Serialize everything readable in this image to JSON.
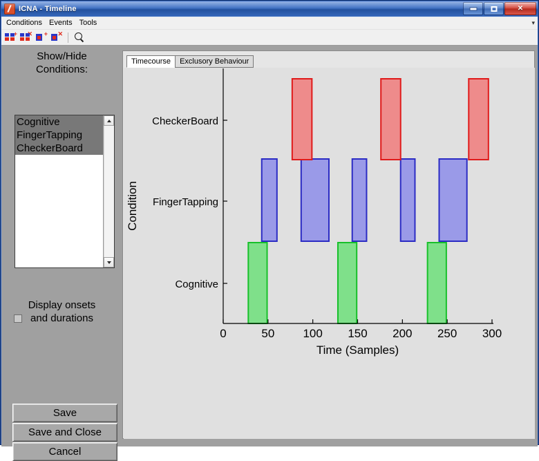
{
  "window": {
    "title": "ICNA - Timeline",
    "app_icon": "matlab-icon",
    "buttons": {
      "minimize": "minimize-icon",
      "maximize": "maximize-icon",
      "close": "✕"
    }
  },
  "menubar": {
    "items": [
      "Conditions",
      "Events",
      "Tools"
    ],
    "overflow": "▾"
  },
  "toolbar": {
    "items": [
      {
        "name": "add-condition-button",
        "icon": "bars-plus-icon",
        "mark": "+"
      },
      {
        "name": "delete-condition-button",
        "icon": "bars-cross-icon",
        "mark": "×"
      },
      {
        "name": "add-event-button",
        "icon": "bar-plus-icon",
        "mark": "+"
      },
      {
        "name": "delete-event-button",
        "icon": "bar-cross-icon",
        "mark": "×"
      },
      {
        "name": "zoom-button",
        "icon": "magnifier-icon",
        "mark": ""
      }
    ]
  },
  "sidebar": {
    "showhide_label_line1": "Show/Hide",
    "showhide_label_line2": "Conditions:",
    "conditions": [
      {
        "label": "Cognitive",
        "selected": true
      },
      {
        "label": "FingerTapping",
        "selected": true
      },
      {
        "label": "CheckerBoard",
        "selected": true
      }
    ],
    "display_onsets_line1": "Display onsets",
    "display_onsets_line2": "and durations",
    "display_onsets_checked": false,
    "buttons": {
      "save": "Save",
      "save_and_close": "Save and Close",
      "cancel": "Cancel"
    }
  },
  "tabs": [
    {
      "label": "Timecourse",
      "active": true
    },
    {
      "label": "Exclusory Behaviour",
      "active": false
    }
  ],
  "chart_data": {
    "type": "bar",
    "title": "",
    "xlabel": "Time (Samples)",
    "ylabel": "Condition",
    "xlim": [
      0,
      300
    ],
    "xticks": [
      0,
      50,
      100,
      150,
      200,
      250,
      300
    ],
    "xticklabels": [
      "0",
      "50",
      "100",
      "150",
      "200",
      "250",
      "300"
    ],
    "ycategories": [
      "Cognitive",
      "FingerTapping",
      "CheckerBoard"
    ],
    "yticklabels": [
      "Cognitive",
      "FingerTapping",
      "CheckerBoard"
    ],
    "grid": false,
    "legend": "none",
    "series": [
      {
        "name": "Cognitive",
        "color": "#7fe08a",
        "edge_color": "#17c02a",
        "row": 0,
        "blocks": [
          {
            "onset": 28,
            "duration": 21
          },
          {
            "onset": 128,
            "duration": 21
          },
          {
            "onset": 228,
            "duration": 21
          }
        ]
      },
      {
        "name": "FingerTapping",
        "color": "#9a9ae8",
        "edge_color": "#2b2bc4",
        "row": 1,
        "blocks": [
          {
            "onset": 43,
            "duration": 17
          },
          {
            "onset": 87,
            "duration": 31
          },
          {
            "onset": 144,
            "duration": 16
          },
          {
            "onset": 198,
            "duration": 16
          },
          {
            "onset": 241,
            "duration": 31
          }
        ]
      },
      {
        "name": "CheckerBoard",
        "color": "#ee8b8b",
        "edge_color": "#e01b1b",
        "row": 2,
        "blocks": [
          {
            "onset": 77,
            "duration": 22
          },
          {
            "onset": 176,
            "duration": 22
          },
          {
            "onset": 274,
            "duration": 22
          }
        ]
      }
    ]
  }
}
